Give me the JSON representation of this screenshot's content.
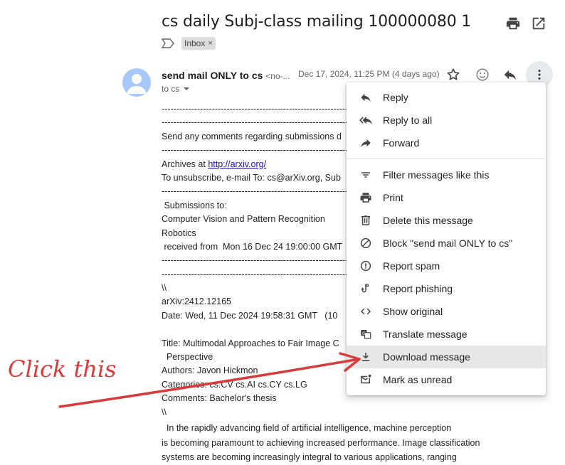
{
  "email": {
    "subject": "cs daily Subj-class mailing 100000080 1",
    "label": "Inbox",
    "label_remove": "×",
    "sender_name": "send mail ONLY to cs",
    "sender_email": "<no-...",
    "date": "Dec 17, 2024, 11:25 PM (4 days ago)",
    "to": "to cs"
  },
  "body_lines": [
    "------------------------------------------------------------------------------------------",
    "------------------------------------------------------------------------------------------",
    "Send any comments regarding submissions d",
    "------------------------------------------------------------------------------------------",
    "Archives at |http://arxiv.org/",
    "To unsubscribe, e-mail To: cs@arXiv.org, Sub",
    "------------------------------------------------------------------------------------------",
    " Submissions to:",
    "Computer Vision and Pattern Recognition",
    "Robotics",
    " received from  Mon 16 Dec 24 19:00:00 GMT",
    "------------------------------------------------------------------------------------------",
    "------------------------------------------------------------------------------------------",
    "\\\\",
    "arXiv:2412.12165",
    "Date: Wed, 11 Dec 2024 19:58:31 GMT   (10",
    "",
    "Title: Multimodal Approaches to Fair Image C",
    "  Perspective",
    "Authors: Javon Hickmon",
    "Categories: cs.CV cs.AI cs.CY cs.LG",
    "Comments: Bachelor's thesis",
    "\\\\"
  ],
  "abstract_lines": [
    "  In the rapidly advancing field of artificial intelligence, machine perception",
    "is becoming paramount to achieving increased performance. Image classification",
    "systems are becoming increasingly integral to various applications, ranging"
  ],
  "menu": {
    "items": [
      {
        "label": "Reply",
        "icon": "reply-icon"
      },
      {
        "label": "Reply to all",
        "icon": "reply-all-icon"
      },
      {
        "label": "Forward",
        "icon": "forward-icon"
      },
      {
        "label": "Filter messages like this",
        "icon": "filter-icon"
      },
      {
        "label": "Print",
        "icon": "print-icon"
      },
      {
        "label": "Delete this message",
        "icon": "trash-icon"
      },
      {
        "label": "Block \"send mail ONLY to cs\"",
        "icon": "block-icon"
      },
      {
        "label": "Report spam",
        "icon": "spam-icon"
      },
      {
        "label": "Report phishing",
        "icon": "phishing-hook-icon"
      },
      {
        "label": "Show original",
        "icon": "code-icon"
      },
      {
        "label": "Translate message",
        "icon": "translate-icon"
      },
      {
        "label": "Download message",
        "icon": "download-icon"
      },
      {
        "label": "Mark as unread",
        "icon": "mark-unread-icon"
      }
    ],
    "highlighted": "Download message"
  },
  "annotation": {
    "text": "Click this",
    "color": "#d93b3b"
  }
}
